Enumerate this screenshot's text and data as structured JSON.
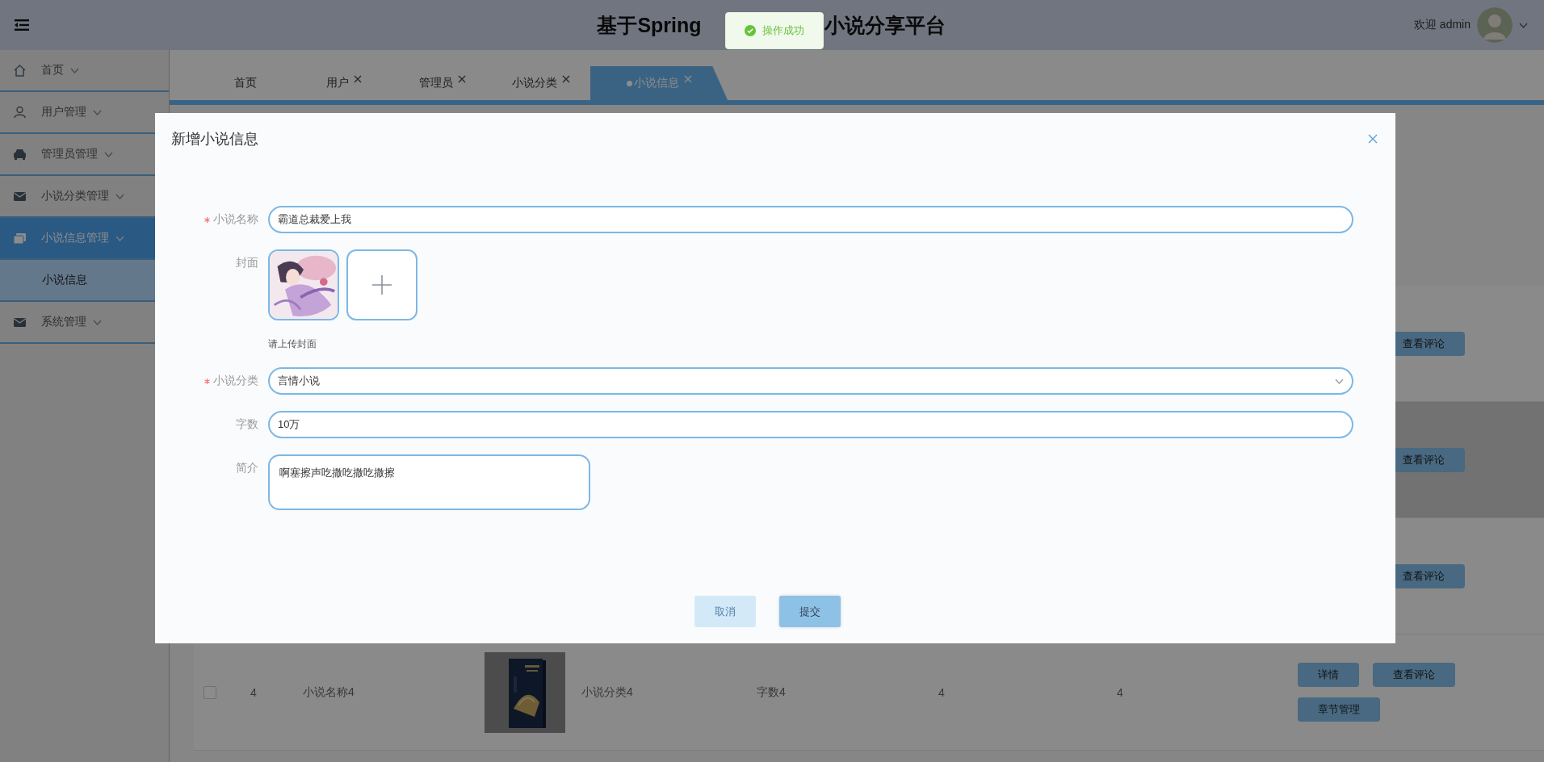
{
  "header": {
    "title_parts": [
      "基于Spring",
      "小说分享平台"
    ],
    "welcome": "欢迎 admin"
  },
  "toast": {
    "kind": "success",
    "message": "操作成功"
  },
  "sidebar": {
    "items": [
      {
        "label": "首页",
        "selected": false
      },
      {
        "label": "用户管理",
        "selected": false
      },
      {
        "label": "管理员管理",
        "selected": false
      },
      {
        "label": "小说分类管理",
        "selected": false
      },
      {
        "label": "小说信息管理",
        "selected": true,
        "children": [
          {
            "label": "小说信息",
            "selected": true
          }
        ]
      },
      {
        "label": "系统管理",
        "selected": false
      }
    ]
  },
  "tabs": [
    {
      "label": "首页",
      "closable": false,
      "selected": false
    },
    {
      "label": "用户",
      "closable": true,
      "selected": false
    },
    {
      "label": "管理员",
      "closable": true,
      "selected": false
    },
    {
      "label": "小说分类",
      "closable": true,
      "selected": false
    },
    {
      "label": "小说信息",
      "closable": true,
      "selected": true
    }
  ],
  "table": {
    "rows": [
      {
        "highlighted": false,
        "actions": [
          "查看评论"
        ]
      },
      {
        "highlighted": true,
        "actions": [
          "查看评论"
        ]
      },
      {
        "highlighted": false,
        "actions": [
          "查看评论"
        ]
      },
      {
        "highlighted": false,
        "checked": false,
        "index": "4",
        "novel_name": "小说名称4",
        "cover": {
          "kind": "picture"
        },
        "category": "小说分类4",
        "word_count": "字数4",
        "column_7": "4",
        "column_8": "4",
        "actions": [
          "详情",
          "查看评论",
          "章节管理"
        ]
      }
    ]
  },
  "dialog": {
    "title": "新增小说信息",
    "fields": [
      {
        "kind": "text",
        "label": "小说名称",
        "required": true,
        "value": "霸道总裁爱上我"
      },
      {
        "kind": "upload",
        "label": "封面",
        "required": false,
        "hint": "请上传封面"
      },
      {
        "kind": "select",
        "label": "小说分类",
        "required": true,
        "value": "言情小说"
      },
      {
        "kind": "text",
        "label": "字数",
        "required": false,
        "value": "10万"
      },
      {
        "kind": "textarea",
        "label": "简介",
        "required": false,
        "value": "啊塞擦声吃撒吃撒吃撒擦"
      }
    ],
    "buttons": [
      {
        "kind": "cancel",
        "label": "取消"
      },
      {
        "kind": "submit",
        "label": "提交"
      }
    ]
  }
}
